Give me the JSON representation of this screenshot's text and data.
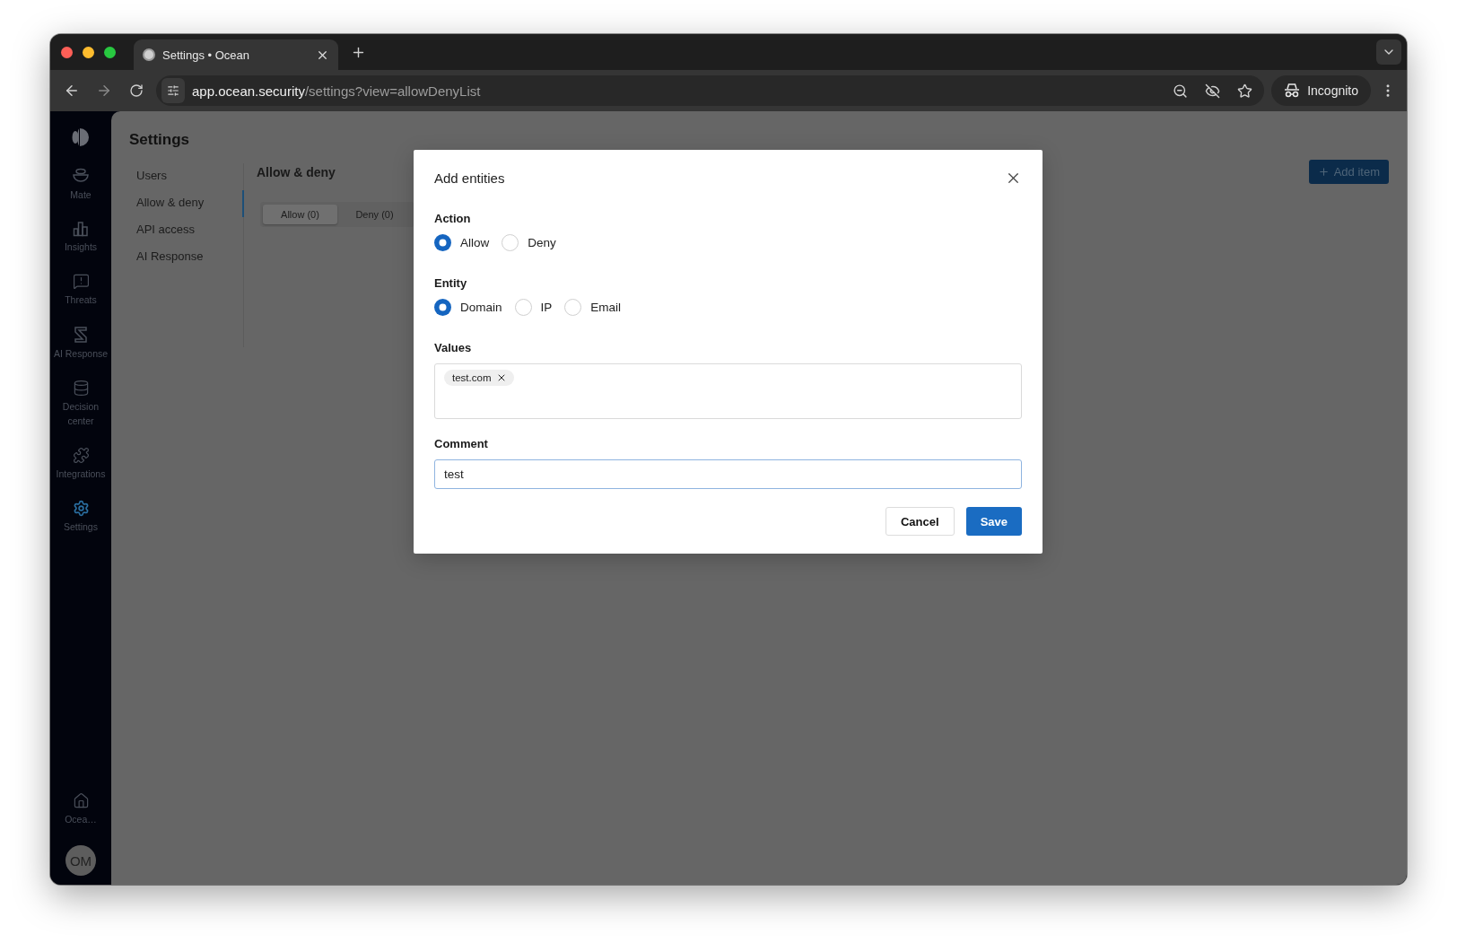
{
  "browser": {
    "tab_title": "Settings • Ocean",
    "url_host": "app.ocean.security",
    "url_path": "/settings?view=allowDenyList",
    "profile": "Incognito"
  },
  "sidebar": {
    "items": [
      {
        "label": "Mate",
        "selected": false
      },
      {
        "label": "Insights",
        "selected": false
      },
      {
        "label": "Threats",
        "selected": false
      },
      {
        "label": "AI Response",
        "selected": false
      },
      {
        "label": "Decision center",
        "selected": false
      },
      {
        "label": "Integrations",
        "selected": false
      },
      {
        "label": "Settings",
        "selected": true
      }
    ],
    "org": "Ocea…",
    "avatar": "OM"
  },
  "settings": {
    "title": "Settings",
    "nav": [
      {
        "label": "Users",
        "selected": false
      },
      {
        "label": "Allow & deny",
        "selected": true
      },
      {
        "label": "API access",
        "selected": false
      },
      {
        "label": "AI Response",
        "selected": false
      }
    ],
    "section_title": "Allow & deny",
    "tabs": [
      {
        "label": "Allow (0)",
        "selected": true
      },
      {
        "label": "Deny (0)",
        "selected": false
      }
    ],
    "add_button": "Add item"
  },
  "dialog": {
    "title": "Add entities",
    "action": {
      "label": "Action",
      "options": [
        {
          "label": "Allow",
          "selected": true
        },
        {
          "label": "Deny",
          "selected": false
        }
      ]
    },
    "entity": {
      "label": "Entity",
      "options": [
        {
          "label": "Domain",
          "selected": true
        },
        {
          "label": "IP",
          "selected": false
        },
        {
          "label": "Email",
          "selected": false
        }
      ]
    },
    "values": {
      "label": "Values",
      "tags": [
        "test.com"
      ]
    },
    "comment": {
      "label": "Comment",
      "value": "test"
    },
    "buttons": {
      "cancel": "Cancel",
      "save": "Save"
    }
  }
}
